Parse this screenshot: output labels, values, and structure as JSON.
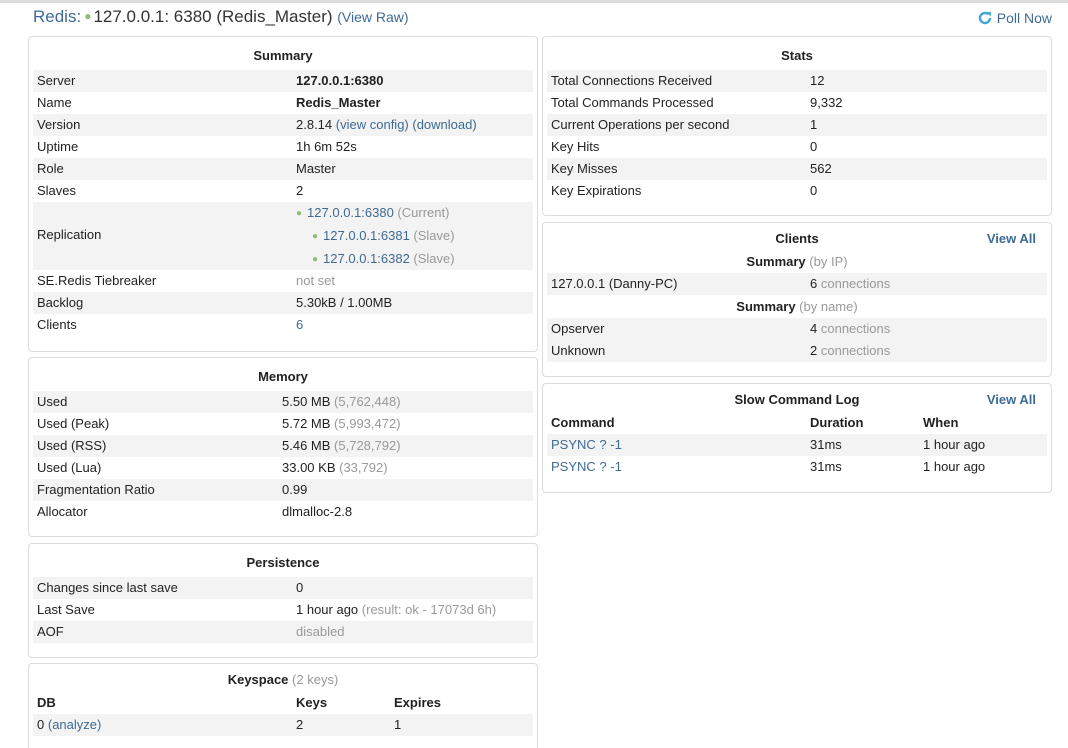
{
  "header": {
    "app_name": "Redis:",
    "status_dot": "●",
    "server_title": "127.0.0.1: 6380 (Redis_Master)",
    "view_raw": "(View Raw)",
    "poll_now": "Poll Now"
  },
  "summary": {
    "title": "Summary",
    "server": {
      "label": "Server",
      "value": "127.0.0.1:6380"
    },
    "name": {
      "label": "Name",
      "value": "Redis_Master"
    },
    "version": {
      "label": "Version",
      "value": "2.8.14",
      "view_config": "(view config)",
      "download": "(download)"
    },
    "uptime": {
      "label": "Uptime",
      "value": "1h 6m 52s"
    },
    "role": {
      "label": "Role",
      "value": "Master"
    },
    "slaves": {
      "label": "Slaves",
      "value": "2"
    },
    "replication": {
      "label": "Replication",
      "nodes": [
        {
          "address": "127.0.0.1:6380",
          "role": "(Current)"
        },
        {
          "address": "127.0.0.1:6381",
          "role": "(Slave)"
        },
        {
          "address": "127.0.0.1:6382",
          "role": "(Slave)"
        }
      ]
    },
    "tiebreaker": {
      "label": "SE.Redis Tiebreaker",
      "value": "not set"
    },
    "backlog": {
      "label": "Backlog",
      "value": "5.30kB / 1.00MB"
    },
    "clients": {
      "label": "Clients",
      "value": "6"
    }
  },
  "memory": {
    "title": "Memory",
    "rows": [
      {
        "label": "Used",
        "value": "5.50 MB",
        "detail": "(5,762,448)"
      },
      {
        "label": "Used (Peak)",
        "value": "5.72 MB",
        "detail": "(5,993,472)"
      },
      {
        "label": "Used (RSS)",
        "value": "5.46 MB",
        "detail": "(5,728,792)"
      },
      {
        "label": "Used (Lua)",
        "value": "33.00 KB",
        "detail": "(33,792)"
      },
      {
        "label": "Fragmentation Ratio",
        "value": "0.99",
        "detail": ""
      },
      {
        "label": "Allocator",
        "value": "dlmalloc-2.8",
        "detail": ""
      }
    ]
  },
  "persistence": {
    "title": "Persistence",
    "changes": {
      "label": "Changes since last save",
      "value": "0"
    },
    "last_save": {
      "label": "Last Save",
      "value": "1 hour ago",
      "detail": "(result: ok - 17073d 6h)"
    },
    "aof": {
      "label": "AOF",
      "value": "disabled"
    }
  },
  "keyspace": {
    "title": "Keyspace",
    "subtitle": "(2 keys)",
    "headers": {
      "db": "DB",
      "keys": "Keys",
      "expires": "Expires"
    },
    "rows": [
      {
        "db": "0",
        "analyze": "(analyze)",
        "keys": "2",
        "expires": "1"
      }
    ]
  },
  "stats": {
    "title": "Stats",
    "rows": [
      {
        "label": "Total Connections Received",
        "value": "12"
      },
      {
        "label": "Total Commands Processed",
        "value": "9,332"
      },
      {
        "label": "Current Operations per second",
        "value": "1"
      },
      {
        "label": "Key Hits",
        "value": "0"
      },
      {
        "label": "Key Misses",
        "value": "562"
      },
      {
        "label": "Key Expirations",
        "value": "0"
      }
    ]
  },
  "clients": {
    "title": "Clients",
    "view_all": "View All",
    "by_ip": {
      "heading": "Summary",
      "qualifier": "(by IP)",
      "rows": [
        {
          "name": "127.0.0.1 (Danny-PC)",
          "count": "6",
          "unit": "connections"
        }
      ]
    },
    "by_name": {
      "heading": "Summary",
      "qualifier": "(by name)",
      "rows": [
        {
          "name": "Opserver",
          "count": "4",
          "unit": "connections"
        },
        {
          "name": "Unknown",
          "count": "2",
          "unit": "connections"
        }
      ]
    }
  },
  "slowlog": {
    "title": "Slow Command Log",
    "view_all": "View All",
    "headers": {
      "command": "Command",
      "duration": "Duration",
      "when": "When"
    },
    "rows": [
      {
        "command": "PSYNC ? -1",
        "duration": "31ms",
        "when": "1 hour ago"
      },
      {
        "command": "PSYNC ? -1",
        "duration": "31ms",
        "when": "1 hour ago"
      }
    ]
  }
}
